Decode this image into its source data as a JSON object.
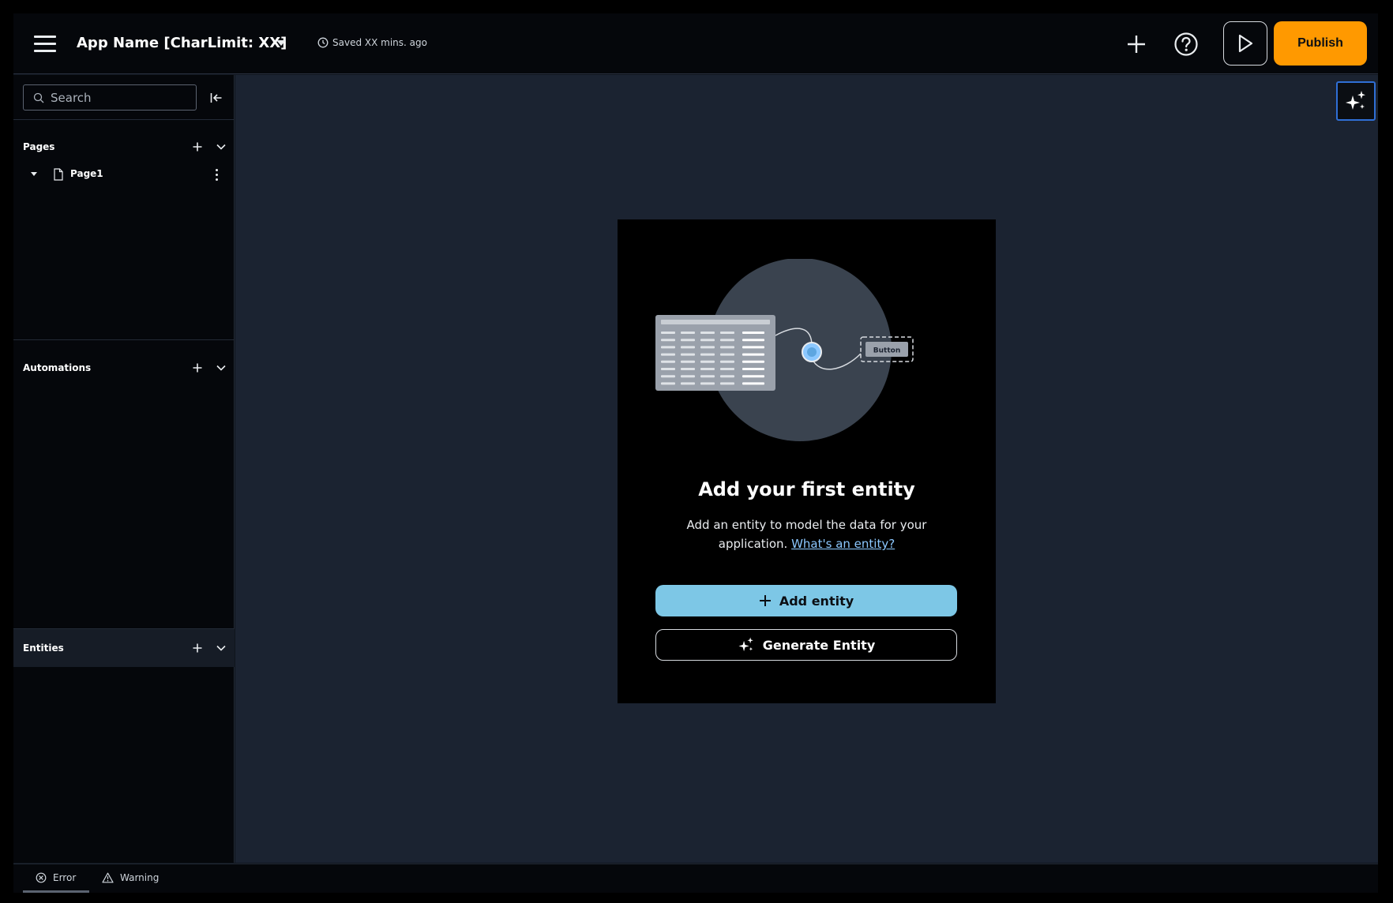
{
  "topbar": {
    "app_name": "App Name [CharLimit: XX]",
    "saved_status": "Saved XX mins. ago",
    "publish_label": "Publish"
  },
  "sidebar": {
    "search": {
      "placeholder": "Search",
      "value": ""
    },
    "sections": [
      {
        "title": "Pages"
      },
      {
        "title": "Automations"
      },
      {
        "title": "Entities"
      }
    ],
    "pages": [
      {
        "label": "Page1"
      }
    ]
  },
  "canvas": {
    "illustration": {
      "button_label": "Button"
    },
    "empty_state": {
      "title": "Add your first entity",
      "description": "Add an entity to model the data for your application.",
      "link_label": "What's an entity?",
      "primary_button": "Add entity",
      "secondary_button": "Generate Entity"
    }
  },
  "bottombar": {
    "error_label": "Error",
    "warning_label": "Warning"
  },
  "colors": {
    "accent_orange": "#ff9900",
    "primary_blue": "#7dc7e6",
    "link_blue": "#8cc8ff",
    "focus_blue": "#2f6fd6",
    "canvas_bg": "#1b2331"
  }
}
